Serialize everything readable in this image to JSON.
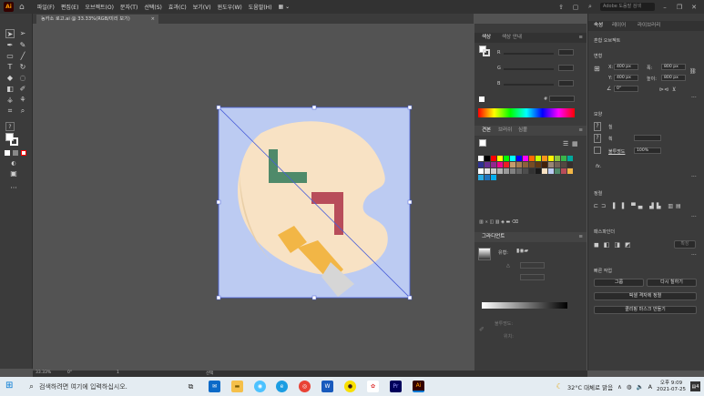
{
  "app": {
    "logo": "Ai"
  },
  "menu": [
    "파일(F)",
    "편집(E)",
    "오브젝트(O)",
    "문자(T)",
    "선택(S)",
    "효과(C)",
    "보기(V)",
    "윈도우(W)",
    "도움말(H)"
  ],
  "menu_right": {
    "search_placeholder": "Adobe 도움말 검색"
  },
  "document_tab": {
    "label": "농카소 로고.ai @ 33.33%(RGB/미리 보기)",
    "close": "×"
  },
  "color_panel": {
    "tabs": [
      "색상",
      "색상 안내"
    ],
    "channels": [
      "R",
      "G",
      "B"
    ],
    "hex": "#"
  },
  "swatch_panel": {
    "tabs": [
      "견본",
      "브러쉬",
      "심볼"
    ]
  },
  "gradient_panel": {
    "title": "그라디언트",
    "type_label": "유형:",
    "opacity_label": "불투명도:",
    "location_label": "위치:"
  },
  "properties_panel": {
    "tabs": [
      "속성",
      "레이어",
      "라이브러리"
    ],
    "header": "혼합 오브젝트",
    "transform_label": "변형",
    "x_label": "X:",
    "x_value": "400 px",
    "y_label": "Y:",
    "y_value": "400 px",
    "w_label": "폭:",
    "w_value": "800 px",
    "h_label": "높이:",
    "h_value": "800 px",
    "angle_value": "0°",
    "appearance_label": "모양",
    "fill_label": "칠",
    "stroke_label": "획",
    "opacity_label": "불투명도",
    "opacity_value": "100%",
    "fx_label": "fx.",
    "align_label": "정렬",
    "pathfinder_label": "패스파인더",
    "expand_label": "확장",
    "quick_actions_label": "빠른 작업",
    "group_button": "그룹",
    "recolor_button": "다시 칠하기",
    "pixel_align_button": "픽셀 격자에 정렬",
    "clipping_mask_button": "클리핑 마스크 만들기"
  },
  "status": {
    "zoom": "33.33%",
    "rotate": "0°",
    "page": "1",
    "tool": "선택"
  },
  "taskbar": {
    "search_placeholder": "검색하려면 여기에 입력하십시오.",
    "weather": "32°C 대체로 맑음",
    "ime": "A",
    "time": "오후 9:09",
    "date": "2021-07-25",
    "notification_count": "4"
  },
  "colors": {
    "artboard_bg": "#bccbf2",
    "palette": "#f8e2c4",
    "green": "#4f8a6a",
    "red": "#b84d5a",
    "orange": "#f2b646"
  }
}
